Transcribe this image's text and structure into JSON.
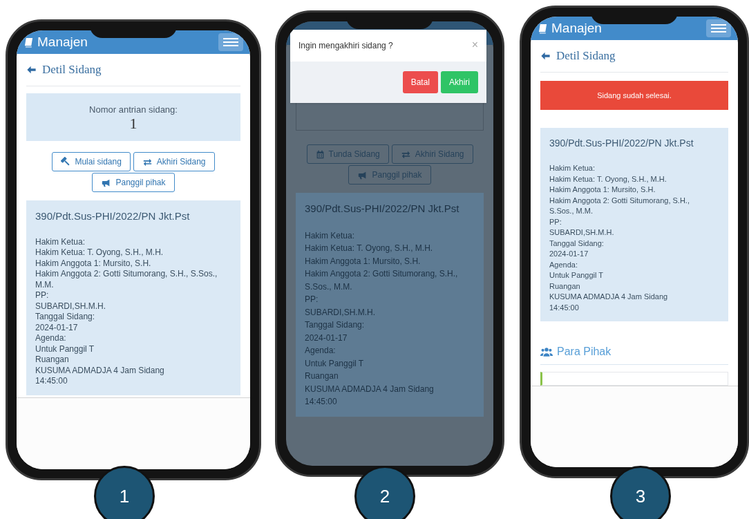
{
  "phones": [
    {
      "step": "1",
      "dimmed": false,
      "header": {
        "title": "Manajen"
      },
      "page_title": "Detil Sidang",
      "queue": {
        "label": "Nomor antrian sidang:",
        "number": "1"
      },
      "buttons": [
        {
          "kind": "gavel",
          "label": "Mulai sidang"
        },
        {
          "kind": "exchange",
          "label": "Akhiri Sidang"
        },
        {
          "kind": "bullhorn",
          "label": "Panggil pihak"
        }
      ],
      "case": {
        "number": "390/Pdt.Sus-PHI/2022/PN Jkt.Pst",
        "lines": [
          "Hakim Ketua:",
          "Hakim Ketua: T. Oyong, S.H., M.H.",
          "Hakim Anggota 1: Mursito, S.H.",
          "Hakim Anggota 2: Gotti Situmorang, S.H., S.Sos., M.M.",
          "PP:",
          "SUBARDI,SH.M.H.",
          "Tanggal Sidang:",
          "2024-01-17",
          "Agenda:",
          "Untuk Panggil T",
          "Ruangan",
          "KUSUMA ADMADJA 4 Jam Sidang",
          "14:45:00"
        ]
      }
    },
    {
      "step": "2",
      "dimmed": true,
      "obscured_panel": true,
      "dialog": {
        "message": "Ingin mengakhiri sidang ?",
        "close": "×",
        "buttons": [
          {
            "kind": "danger",
            "label": "Batal"
          },
          {
            "kind": "success",
            "label": "Akhiri"
          }
        ]
      },
      "buttons": [
        {
          "kind": "calendar",
          "label": "Tunda Sidang"
        },
        {
          "kind": "exchange",
          "label": "Akhiri Sidang"
        },
        {
          "kind": "bullhorn",
          "label": "Panggil pihak"
        }
      ],
      "case": {
        "number": "390/Pdt.Sus-PHI/2022/PN Jkt.Pst",
        "lines": [
          "Hakim Ketua:",
          "Hakim Ketua: T. Oyong, S.H., M.H.",
          "Hakim Anggota 1: Mursito, S.H.",
          "Hakim Anggota 2: Gotti Situmorang, S.H., S.Sos., M.M.",
          "PP:",
          "SUBARDI,SH.M.H.",
          "Tanggal Sidang:",
          "2024-01-17",
          "Agenda:",
          "Untuk Panggil T",
          "Ruangan",
          "KUSUMA ADMADJA 4 Jam Sidang",
          "14:45:00"
        ]
      }
    },
    {
      "step": "3",
      "dimmed": false,
      "header": {
        "title": "Manajen"
      },
      "page_title": "Detil Sidang",
      "alert": "Sidang sudah selesai.",
      "case": {
        "number": "390/Pdt.Sus-PHI/2022/PN Jkt.Pst",
        "lines": [
          "Hakim Ketua:",
          "Hakim Ketua: T. Oyong, S.H., M.H.",
          "Hakim Anggota 1: Mursito, S.H.",
          "Hakim Anggota 2: Gotti Situmorang, S.H., S.Sos., M.M.",
          "PP:",
          "SUBARDI,SH.M.H.",
          "Tanggal Sidang:",
          "2024-01-17",
          "Agenda:",
          "Untuk Panggil T",
          "Ruangan",
          "KUSUMA ADMADJA 4 Jam Sidang",
          "14:45:00"
        ]
      },
      "section": {
        "title": "Para Pihak"
      }
    }
  ]
}
